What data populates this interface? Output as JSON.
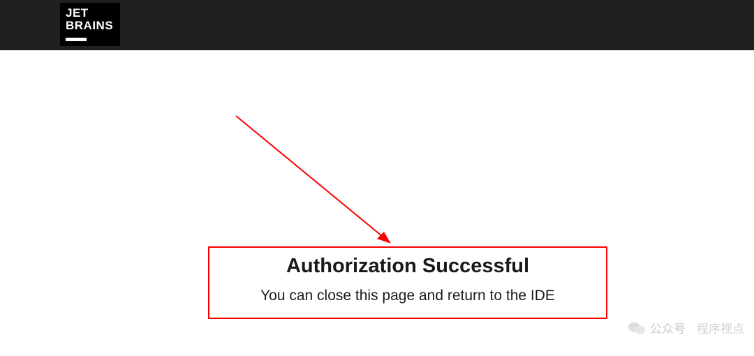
{
  "header": {
    "logo": {
      "line1": "JET",
      "line2": "BRAINS"
    }
  },
  "message": {
    "title": "Authorization Successful",
    "subtitle": "You can close this page and return to the IDE"
  },
  "annotation": {
    "highlight_color": "#ff0000"
  },
  "watermark": {
    "label1": "公众号",
    "label2": "程序视点"
  }
}
